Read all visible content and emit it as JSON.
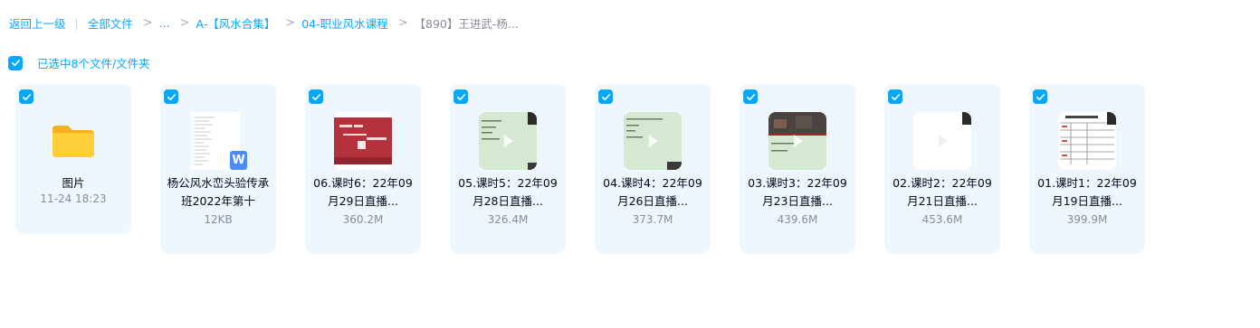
{
  "breadcrumb": {
    "back": "返回上一级",
    "all_files": "全部文件",
    "ellipsis": "...",
    "level1": "A-【风水合集】",
    "level2": "04-职业风水课程",
    "current": "【890】王进武-杨..."
  },
  "selection": {
    "text": "已选中8个文件/文件夹"
  },
  "accent": "#06a7ff",
  "files": [
    {
      "type": "folder",
      "icon": "folder-icon",
      "name": "图片",
      "meta": "11-24 18:23"
    },
    {
      "type": "doc",
      "icon": "word-icon",
      "badge": "W",
      "name": "杨公风水峦头验传承班2022年第十",
      "meta": "12KB"
    },
    {
      "type": "video",
      "name": "06.课时6：22年09月29日直播...",
      "meta": "360.2M"
    },
    {
      "type": "video",
      "name": "05.课时5：22年09月28日直播...",
      "meta": "326.4M"
    },
    {
      "type": "video",
      "name": "04.课时4：22年09月26日直播...",
      "meta": "373.7M"
    },
    {
      "type": "video",
      "name": "03.课时3：22年09月23日直播...",
      "meta": "439.6M"
    },
    {
      "type": "video",
      "name": "02.课时2：22年09月21日直播...",
      "meta": "453.6M"
    },
    {
      "type": "video",
      "name": "01.课时1：22年09月19日直播...",
      "meta": "399.9M"
    }
  ]
}
